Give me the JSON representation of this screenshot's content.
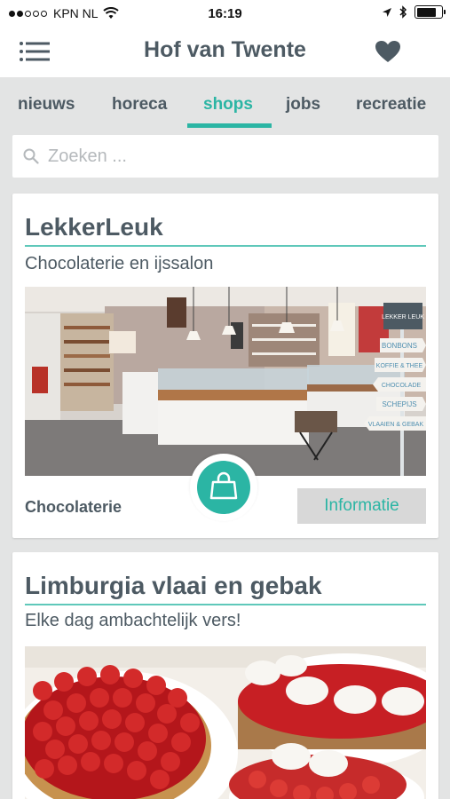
{
  "status_bar": {
    "carrier": "KPN NL",
    "time": "16:19"
  },
  "header": {
    "title": "Hof van Twente",
    "menu_icon": "hamburger-menu-icon",
    "favorite_icon": "heart-icon"
  },
  "tabs": [
    {
      "label": "nieuws",
      "active": false
    },
    {
      "label": "horeca",
      "active": false
    },
    {
      "label": "shops",
      "active": true
    },
    {
      "label": "jobs",
      "active": false
    },
    {
      "label": "recreatie",
      "active": false
    }
  ],
  "search": {
    "placeholder": "Zoeken ...",
    "value": "",
    "icon": "search-icon"
  },
  "colors": {
    "accent": "#2bb5a4",
    "text": "#4d5a63",
    "background": "#e3e4e4"
  },
  "cards": [
    {
      "title": "LekkerLeuk",
      "subtitle": "Chocolaterie en ijssalon",
      "category": "Chocolaterie",
      "button_label": "Informatie",
      "badge_icon": "shopping-bag-icon",
      "photo": {
        "logo_text": "LEKKER LEUK",
        "signs": [
          "BONBONS",
          "KOFFIE & THEE",
          "CHOCOLADE",
          "SCHEPIJS",
          "VLAAIEN & GEBAK"
        ]
      }
    },
    {
      "title": "Limburgia vlaai en gebak",
      "subtitle": "Elke dag ambachtelijk vers!"
    }
  ]
}
